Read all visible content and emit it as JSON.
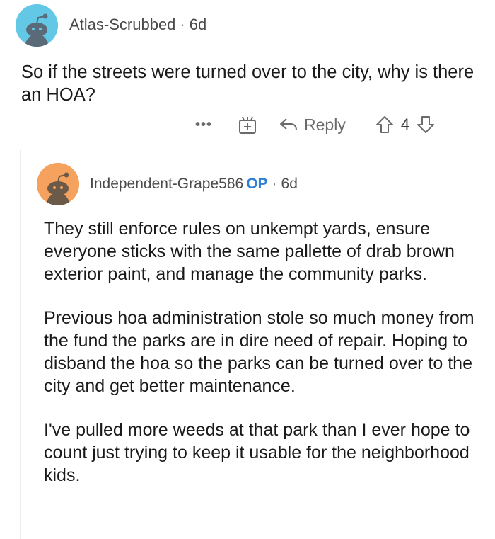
{
  "parent_comment": {
    "username": "Atlas-Scrubbed",
    "age": "6d",
    "separator": "·",
    "body": "So if the streets were turned over to the city, why is there an HOA?",
    "actions": {
      "more_label": "•••",
      "reply_label": "Reply",
      "vote_count": "4"
    }
  },
  "reply_comment": {
    "username": "Independent-Grape586",
    "op_badge": "OP",
    "age": "6d",
    "separator": "·",
    "paragraphs": [
      "They still enforce rules on unkempt yards, ensure everyone sticks with the same pallette of drab brown exterior paint, and manage the community parks.",
      "Previous hoa administration stole so much money from the fund the parks are in dire need of repair.  Hoping to disband the hoa so the parks can be turned over to the city and get better maintenance.",
      "I've pulled more weeds at that park than I ever hope to count just trying to keep it usable for the neighborhood kids."
    ]
  },
  "colors": {
    "parent_avatar_bg": "#62c8e6",
    "reply_avatar_bg": "#f5a25e",
    "op_badge": "#2f7fd6",
    "meta_text": "#4a4a4b"
  },
  "icons": {
    "parent_avatar": "snoo-avatar-icon",
    "reply_avatar": "snoo-avatar-icon",
    "award": "award-icon",
    "reply": "reply-arrow-icon",
    "upvote": "upvote-arrow-icon",
    "downvote": "downvote-arrow-icon"
  }
}
